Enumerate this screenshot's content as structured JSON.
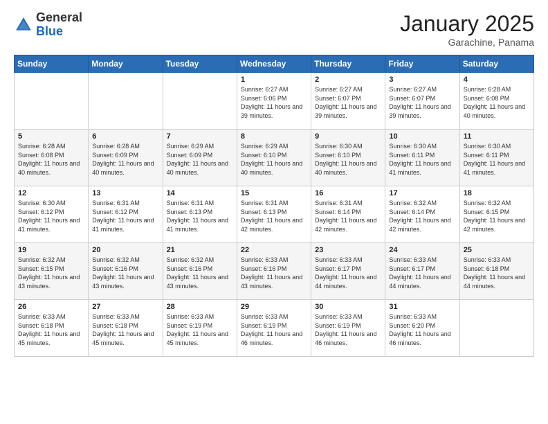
{
  "header": {
    "logo_general": "General",
    "logo_blue": "Blue",
    "month": "January 2025",
    "location": "Garachine, Panama"
  },
  "days_of_week": [
    "Sunday",
    "Monday",
    "Tuesday",
    "Wednesday",
    "Thursday",
    "Friday",
    "Saturday"
  ],
  "weeks": [
    [
      {
        "day": "",
        "info": ""
      },
      {
        "day": "",
        "info": ""
      },
      {
        "day": "",
        "info": ""
      },
      {
        "day": "1",
        "info": "Sunrise: 6:27 AM\nSunset: 6:06 PM\nDaylight: 11 hours and 39 minutes."
      },
      {
        "day": "2",
        "info": "Sunrise: 6:27 AM\nSunset: 6:07 PM\nDaylight: 11 hours and 39 minutes."
      },
      {
        "day": "3",
        "info": "Sunrise: 6:27 AM\nSunset: 6:07 PM\nDaylight: 11 hours and 39 minutes."
      },
      {
        "day": "4",
        "info": "Sunrise: 6:28 AM\nSunset: 6:08 PM\nDaylight: 11 hours and 40 minutes."
      }
    ],
    [
      {
        "day": "5",
        "info": "Sunrise: 6:28 AM\nSunset: 6:08 PM\nDaylight: 11 hours and 40 minutes."
      },
      {
        "day": "6",
        "info": "Sunrise: 6:28 AM\nSunset: 6:09 PM\nDaylight: 11 hours and 40 minutes."
      },
      {
        "day": "7",
        "info": "Sunrise: 6:29 AM\nSunset: 6:09 PM\nDaylight: 11 hours and 40 minutes."
      },
      {
        "day": "8",
        "info": "Sunrise: 6:29 AM\nSunset: 6:10 PM\nDaylight: 11 hours and 40 minutes."
      },
      {
        "day": "9",
        "info": "Sunrise: 6:30 AM\nSunset: 6:10 PM\nDaylight: 11 hours and 40 minutes."
      },
      {
        "day": "10",
        "info": "Sunrise: 6:30 AM\nSunset: 6:11 PM\nDaylight: 11 hours and 41 minutes."
      },
      {
        "day": "11",
        "info": "Sunrise: 6:30 AM\nSunset: 6:11 PM\nDaylight: 11 hours and 41 minutes."
      }
    ],
    [
      {
        "day": "12",
        "info": "Sunrise: 6:30 AM\nSunset: 6:12 PM\nDaylight: 11 hours and 41 minutes."
      },
      {
        "day": "13",
        "info": "Sunrise: 6:31 AM\nSunset: 6:12 PM\nDaylight: 11 hours and 41 minutes."
      },
      {
        "day": "14",
        "info": "Sunrise: 6:31 AM\nSunset: 6:13 PM\nDaylight: 11 hours and 41 minutes."
      },
      {
        "day": "15",
        "info": "Sunrise: 6:31 AM\nSunset: 6:13 PM\nDaylight: 11 hours and 42 minutes."
      },
      {
        "day": "16",
        "info": "Sunrise: 6:31 AM\nSunset: 6:14 PM\nDaylight: 11 hours and 42 minutes."
      },
      {
        "day": "17",
        "info": "Sunrise: 6:32 AM\nSunset: 6:14 PM\nDaylight: 11 hours and 42 minutes."
      },
      {
        "day": "18",
        "info": "Sunrise: 6:32 AM\nSunset: 6:15 PM\nDaylight: 11 hours and 42 minutes."
      }
    ],
    [
      {
        "day": "19",
        "info": "Sunrise: 6:32 AM\nSunset: 6:15 PM\nDaylight: 11 hours and 43 minutes."
      },
      {
        "day": "20",
        "info": "Sunrise: 6:32 AM\nSunset: 6:16 PM\nDaylight: 11 hours and 43 minutes."
      },
      {
        "day": "21",
        "info": "Sunrise: 6:32 AM\nSunset: 6:16 PM\nDaylight: 11 hours and 43 minutes."
      },
      {
        "day": "22",
        "info": "Sunrise: 6:33 AM\nSunset: 6:16 PM\nDaylight: 11 hours and 43 minutes."
      },
      {
        "day": "23",
        "info": "Sunrise: 6:33 AM\nSunset: 6:17 PM\nDaylight: 11 hours and 44 minutes."
      },
      {
        "day": "24",
        "info": "Sunrise: 6:33 AM\nSunset: 6:17 PM\nDaylight: 11 hours and 44 minutes."
      },
      {
        "day": "25",
        "info": "Sunrise: 6:33 AM\nSunset: 6:18 PM\nDaylight: 11 hours and 44 minutes."
      }
    ],
    [
      {
        "day": "26",
        "info": "Sunrise: 6:33 AM\nSunset: 6:18 PM\nDaylight: 11 hours and 45 minutes."
      },
      {
        "day": "27",
        "info": "Sunrise: 6:33 AM\nSunset: 6:18 PM\nDaylight: 11 hours and 45 minutes."
      },
      {
        "day": "28",
        "info": "Sunrise: 6:33 AM\nSunset: 6:19 PM\nDaylight: 11 hours and 45 minutes."
      },
      {
        "day": "29",
        "info": "Sunrise: 6:33 AM\nSunset: 6:19 PM\nDaylight: 11 hours and 46 minutes."
      },
      {
        "day": "30",
        "info": "Sunrise: 6:33 AM\nSunset: 6:19 PM\nDaylight: 11 hours and 46 minutes."
      },
      {
        "day": "31",
        "info": "Sunrise: 6:33 AM\nSunset: 6:20 PM\nDaylight: 11 hours and 46 minutes."
      },
      {
        "day": "",
        "info": ""
      }
    ]
  ]
}
